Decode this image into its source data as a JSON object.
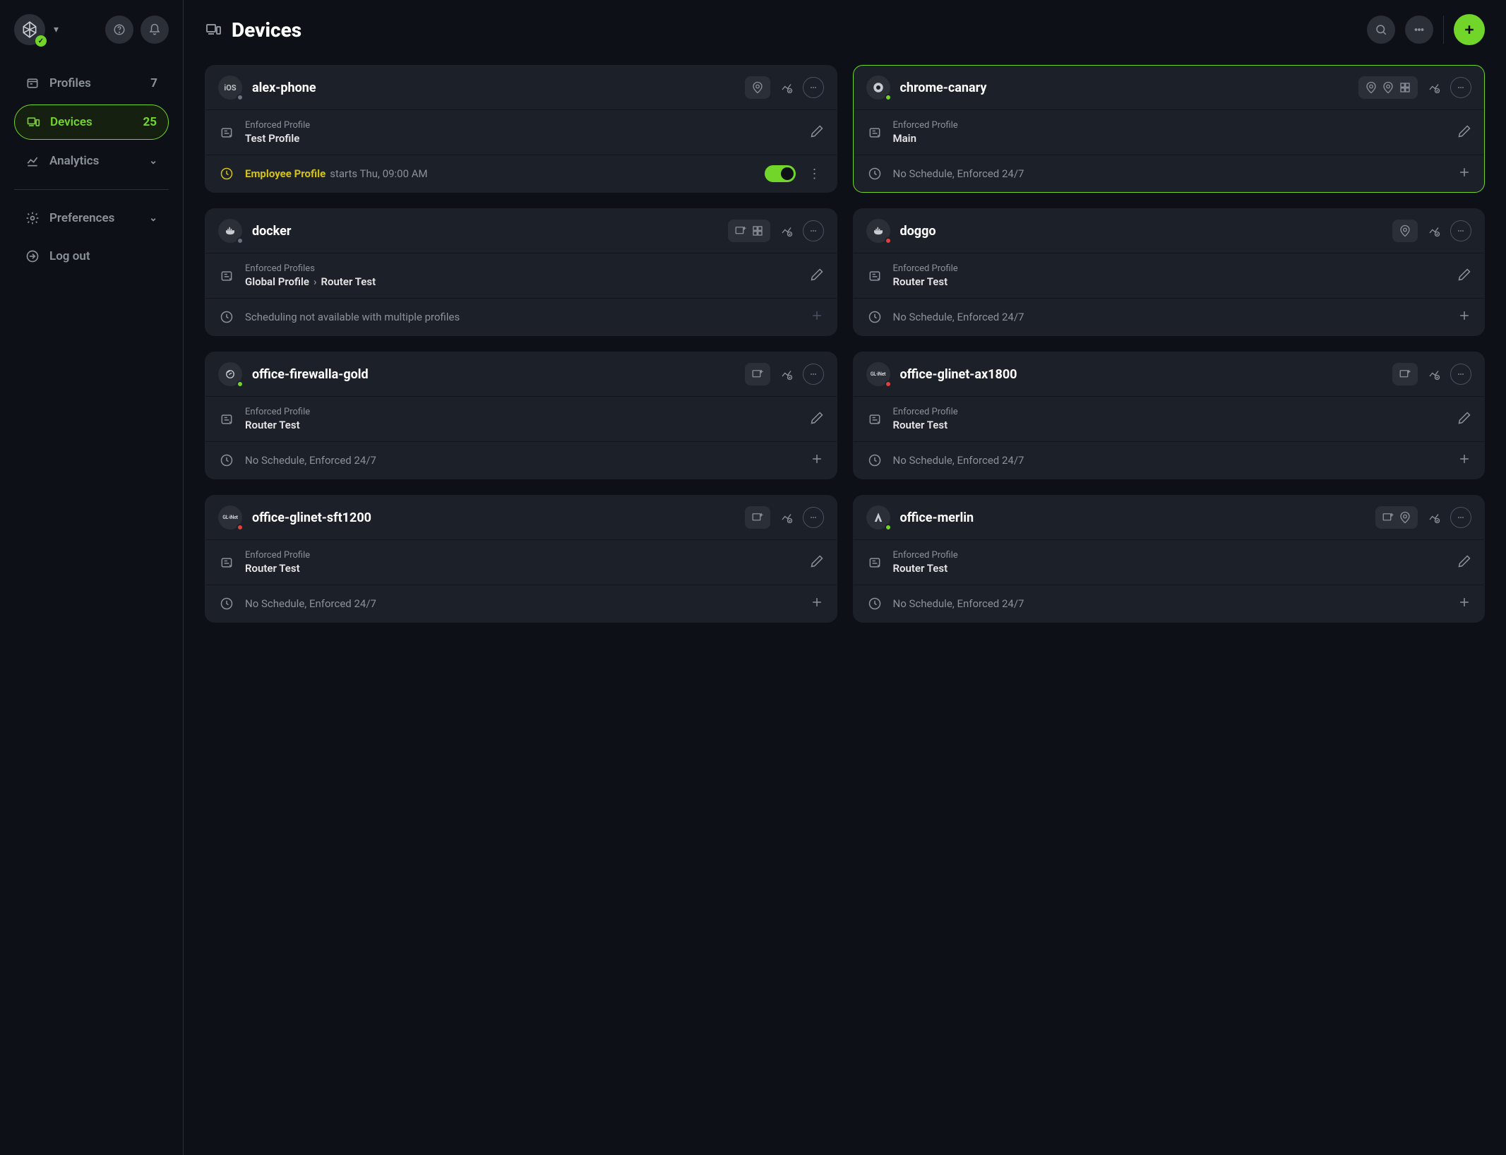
{
  "page": {
    "title": "Devices"
  },
  "sidebar": {
    "items": [
      {
        "label": "Profiles",
        "count": "7"
      },
      {
        "label": "Devices",
        "count": "25"
      },
      {
        "label": "Analytics"
      },
      {
        "label": "Preferences"
      },
      {
        "label": "Log out"
      }
    ]
  },
  "labels": {
    "enforced_profile": "Enforced Profile",
    "enforced_profiles": "Enforced Profiles",
    "no_schedule": "No Schedule, Enforced 24/7",
    "sched_not_avail": "Scheduling not available with multiple profiles"
  },
  "devices": [
    {
      "name": "alex-phone",
      "icon": "ios",
      "status": "grey",
      "badges": [
        "pin"
      ],
      "profile_label": "Enforced Profile",
      "profile_value": "Test Profile",
      "schedule": {
        "type": "active",
        "name": "Employee Profile",
        "when": "starts Thu, 09:00 AM",
        "toggle": true
      }
    },
    {
      "name": "chrome-canary",
      "icon": "chrome",
      "status": "green",
      "highlighted": true,
      "badges": [
        "pin",
        "pin",
        "layout"
      ],
      "profile_label": "Enforced Profile",
      "profile_value": "Main",
      "schedule": {
        "type": "none"
      }
    },
    {
      "name": "docker",
      "icon": "whale",
      "status": "grey",
      "badges": [
        "add-device",
        "layout"
      ],
      "profile_label": "Enforced Profiles",
      "profile_value": "Global Profile",
      "profile_value2": "Router Test",
      "schedule": {
        "type": "unavailable"
      }
    },
    {
      "name": "doggo",
      "icon": "whale",
      "status": "red",
      "badges": [
        "pin"
      ],
      "profile_label": "Enforced Profile",
      "profile_value": "Router Test",
      "schedule": {
        "type": "none"
      }
    },
    {
      "name": "office-firewalla-gold",
      "icon": "firewalla",
      "status": "green",
      "badges": [
        "add-device"
      ],
      "profile_label": "Enforced Profile",
      "profile_value": "Router Test",
      "schedule": {
        "type": "none"
      }
    },
    {
      "name": "office-glinet-ax1800",
      "icon": "glinet",
      "status": "red",
      "badges": [
        "add-device"
      ],
      "profile_label": "Enforced Profile",
      "profile_value": "Router Test",
      "schedule": {
        "type": "none"
      }
    },
    {
      "name": "office-glinet-sft1200",
      "icon": "glinet",
      "status": "red",
      "badges": [
        "add-device"
      ],
      "profile_label": "Enforced Profile",
      "profile_value": "Router Test",
      "schedule": {
        "type": "none"
      }
    },
    {
      "name": "office-merlin",
      "icon": "merlin",
      "status": "green",
      "badges": [
        "add-device",
        "pin"
      ],
      "profile_label": "Enforced Profile",
      "profile_value": "Router Test",
      "schedule": {
        "type": "none"
      }
    }
  ]
}
